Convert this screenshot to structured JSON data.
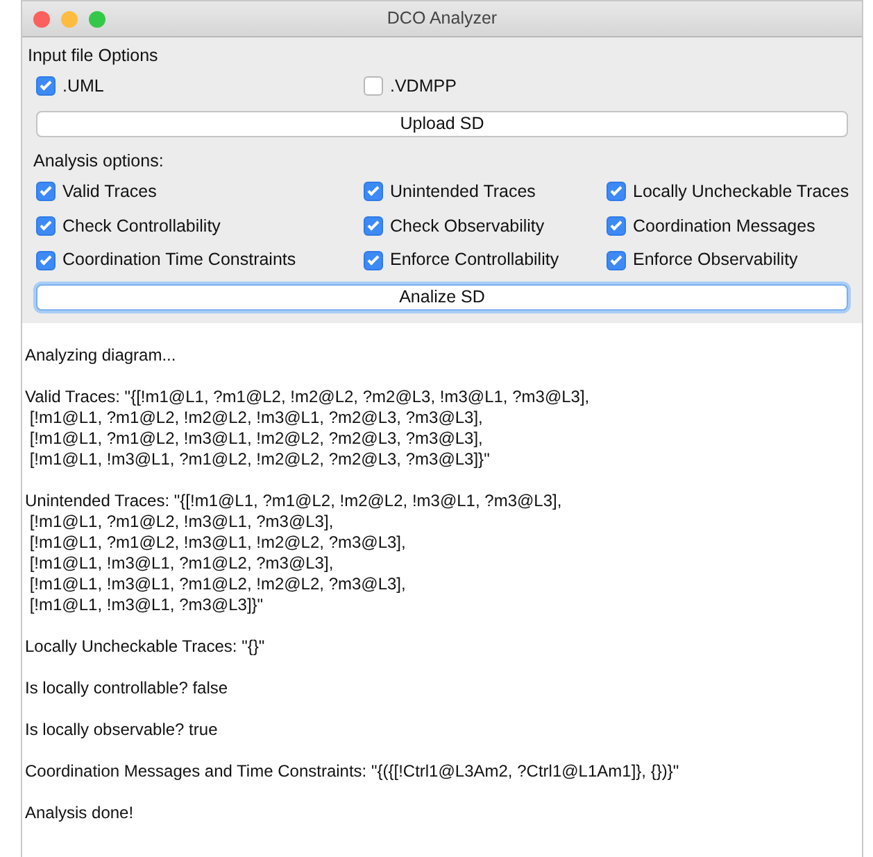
{
  "window": {
    "title": "DCO Analyzer"
  },
  "input_file_options": {
    "label": "Input file Options",
    "options": [
      {
        "label": ".UML",
        "checked": true
      },
      {
        "label": ".VDMPP",
        "checked": false
      }
    ],
    "button": {
      "label": "Upload SD",
      "focused": false
    }
  },
  "analysis_options": {
    "label": "Analysis options:",
    "options": [
      {
        "label": "Valid Traces",
        "checked": true
      },
      {
        "label": "Unintended Traces",
        "checked": true
      },
      {
        "label": "Locally Uncheckable Traces",
        "checked": true
      },
      {
        "label": "Check Controllability",
        "checked": true
      },
      {
        "label": "Check Observability",
        "checked": true
      },
      {
        "label": "Coordination Messages",
        "checked": true
      },
      {
        "label": "Coordination Time Constraints",
        "checked": true
      },
      {
        "label": "Enforce Controllability",
        "checked": true
      },
      {
        "label": "Enforce Observability",
        "checked": true
      }
    ],
    "button": {
      "label": "Analize SD",
      "focused": true
    }
  },
  "output": [
    [
      "Analyzing diagram..."
    ],
    [
      "Valid Traces: \"{[!m1@L1, ?m1@L2, !m2@L2, ?m2@L3, !m3@L1, ?m3@L3],",
      " [!m1@L1, ?m1@L2, !m2@L2, !m3@L1, ?m2@L3, ?m3@L3],",
      " [!m1@L1, ?m1@L2, !m3@L1, !m2@L2, ?m2@L3, ?m3@L3],",
      " [!m1@L1, !m3@L1, ?m1@L2, !m2@L2, ?m2@L3, ?m3@L3]}\""
    ],
    [
      "Unintended Traces: \"{[!m1@L1, ?m1@L2, !m2@L2, !m3@L1, ?m3@L3],",
      " [!m1@L1, ?m1@L2, !m3@L1, ?m3@L3],",
      " [!m1@L1, ?m1@L2, !m3@L1, !m2@L2, ?m3@L3],",
      " [!m1@L1, !m3@L1, ?m1@L2, ?m3@L3],",
      " [!m1@L1, !m3@L1, ?m1@L2, !m2@L2, ?m3@L3],",
      " [!m1@L1, !m3@L1, ?m3@L3]}\""
    ],
    [
      "Locally Uncheckable Traces: \"{}\""
    ],
    [
      "Is locally controllable? false"
    ],
    [
      "Is locally observable? true"
    ],
    [
      "Coordination Messages and Time Constraints: \"{({[!Ctrl1@L3Am2, ?Ctrl1@L1Am1]}, {})}\""
    ],
    [
      "Analysis done!"
    ]
  ]
}
